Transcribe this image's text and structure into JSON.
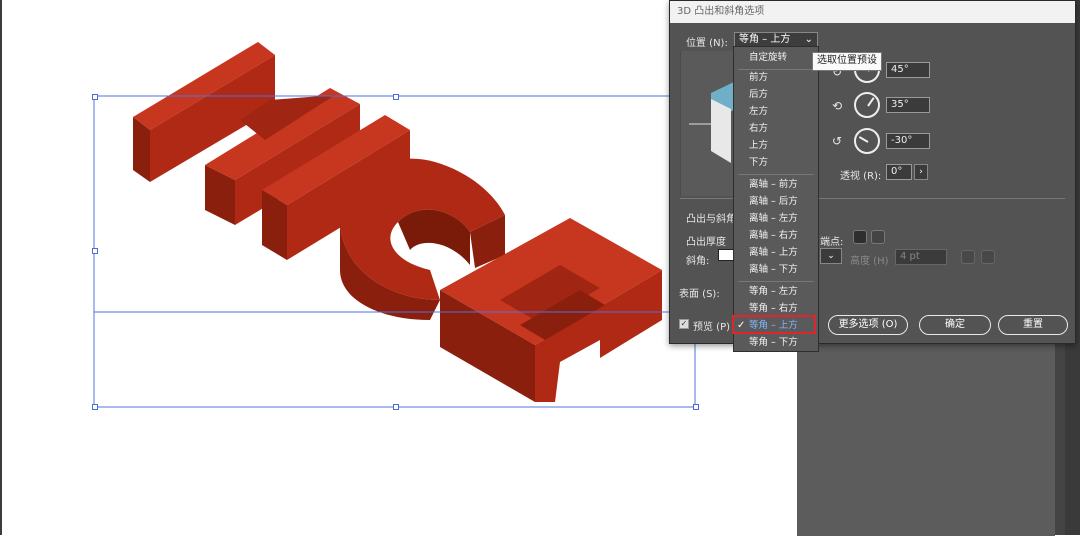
{
  "dialog": {
    "title": "3D 凸出和斜角选项",
    "position_label": "位置 (N):",
    "position_value": "等角 – 上方",
    "extrude_section": "凸出与斜角",
    "extrude_depth_label": "凸出厚度",
    "cap_label": "端点:",
    "bevel_label": "斜角:",
    "height_label": "高度 (H)",
    "height_value": "4 pt",
    "surface_label": "表面 (S):",
    "preview_label": "预览 (P)",
    "rotation": {
      "x": "45°",
      "y": "35°",
      "z": "-30°"
    },
    "perspective_label": "透视 (R):",
    "perspective_value": "0°",
    "buttons": {
      "more": "更多选项 (O)",
      "ok": "确定",
      "reset": "重置"
    }
  },
  "tooltip": "选取位置预设",
  "menu": {
    "items": [
      "自定旋转",
      "前方",
      "后方",
      "左方",
      "右方",
      "上方",
      "下方",
      "离轴 – 前方",
      "离轴 – 后方",
      "离轴 – 左方",
      "离轴 – 右方",
      "离轴 – 上方",
      "离轴 – 下方",
      "等角 – 左方",
      "等角 – 右方",
      "等角 – 上方",
      "等角 – 下方"
    ],
    "selected_index": 15
  },
  "artwork_text": "NICE",
  "colors": {
    "art_front": "#b32a16",
    "art_side": "#8a1e0c",
    "art_top": "#c93a22",
    "selection": "#5470e0",
    "highlight": "#e0262c"
  }
}
